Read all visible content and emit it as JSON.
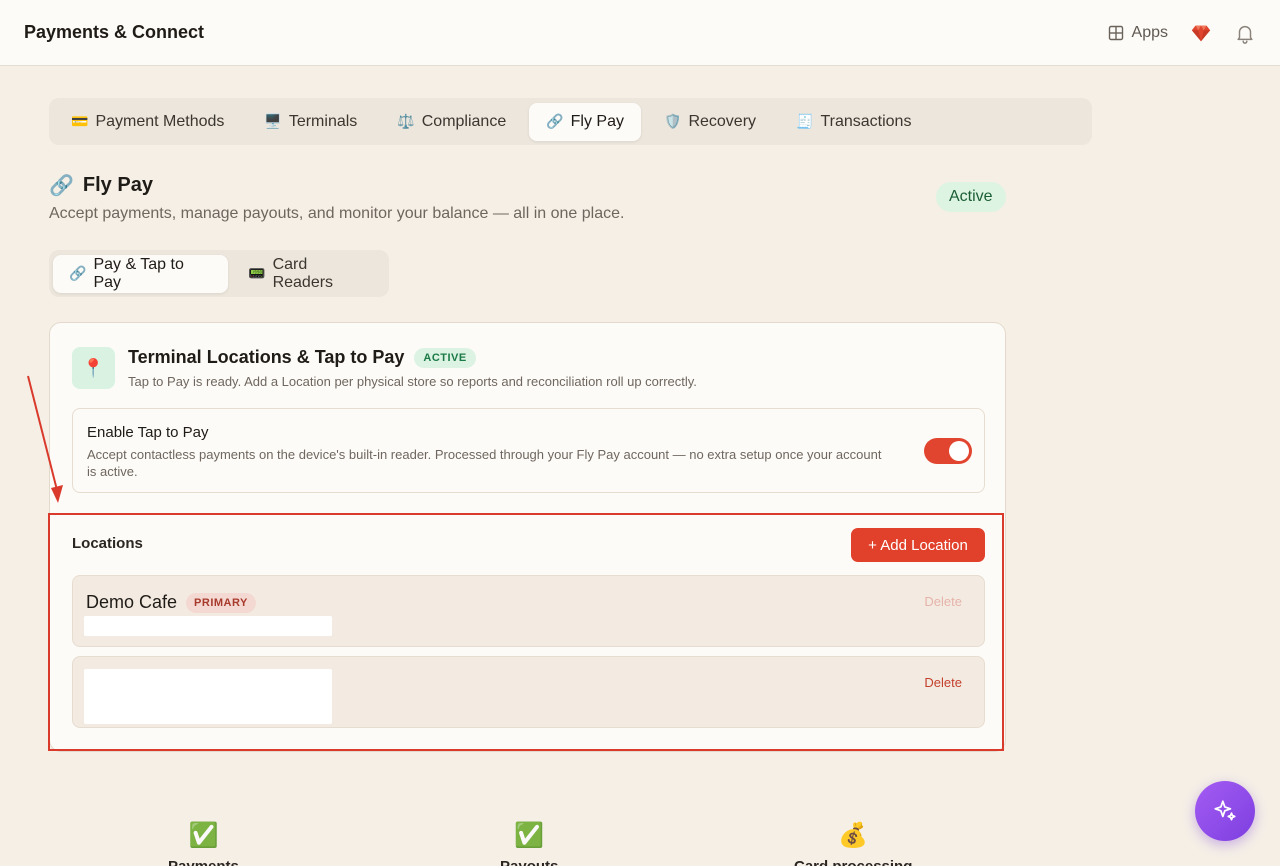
{
  "header": {
    "title": "Payments & Connect",
    "apps_label": "Apps"
  },
  "main_tabs": [
    {
      "icon": "💳",
      "label": "Payment Methods"
    },
    {
      "icon": "🖥️",
      "label": "Terminals"
    },
    {
      "icon": "⚖️",
      "label": "Compliance"
    },
    {
      "icon": "🔗",
      "label": "Fly Pay",
      "active": true
    },
    {
      "icon": "🛡️",
      "label": "Recovery"
    },
    {
      "icon": "🧾",
      "label": "Transactions"
    }
  ],
  "flypay": {
    "icon": "🔗",
    "title": "Fly Pay",
    "subtitle": "Accept payments, manage payouts, and monitor your balance — all in one place.",
    "status": "Active"
  },
  "sub_tabs": [
    {
      "icon": "🔗",
      "label": "Pay & Tap to Pay",
      "active": true
    },
    {
      "icon": "📟",
      "label": "Card Readers"
    }
  ],
  "terminal_card": {
    "icon": "📍",
    "title": "Terminal Locations & Tap to Pay",
    "badge": "ACTIVE",
    "subtitle": "Tap to Pay is ready. Add a Location per physical store so reports and reconciliation roll up correctly.",
    "tap": {
      "title": "Enable Tap to Pay",
      "description": "Accept contactless payments on the device's built-in reader. Processed through your Fly Pay account — no extra setup once your account is active.",
      "enabled": true
    },
    "locations_label": "Locations",
    "add_label": "+ Add Location",
    "locations": [
      {
        "name": "Demo Cafe",
        "badge": "PRIMARY",
        "delete_label": "Delete"
      },
      {
        "name": "",
        "badge": "",
        "delete_label": "Delete"
      }
    ]
  },
  "stats": [
    {
      "icon": "✅",
      "label": "Payments"
    },
    {
      "icon": "✅",
      "label": "Payouts"
    },
    {
      "icon": "💰",
      "label": "Card processing"
    }
  ],
  "colors": {
    "accent": "#e1402a",
    "background": "#f5efe6",
    "success_bg": "#ddf4e3",
    "fab": "#8e4bea"
  }
}
